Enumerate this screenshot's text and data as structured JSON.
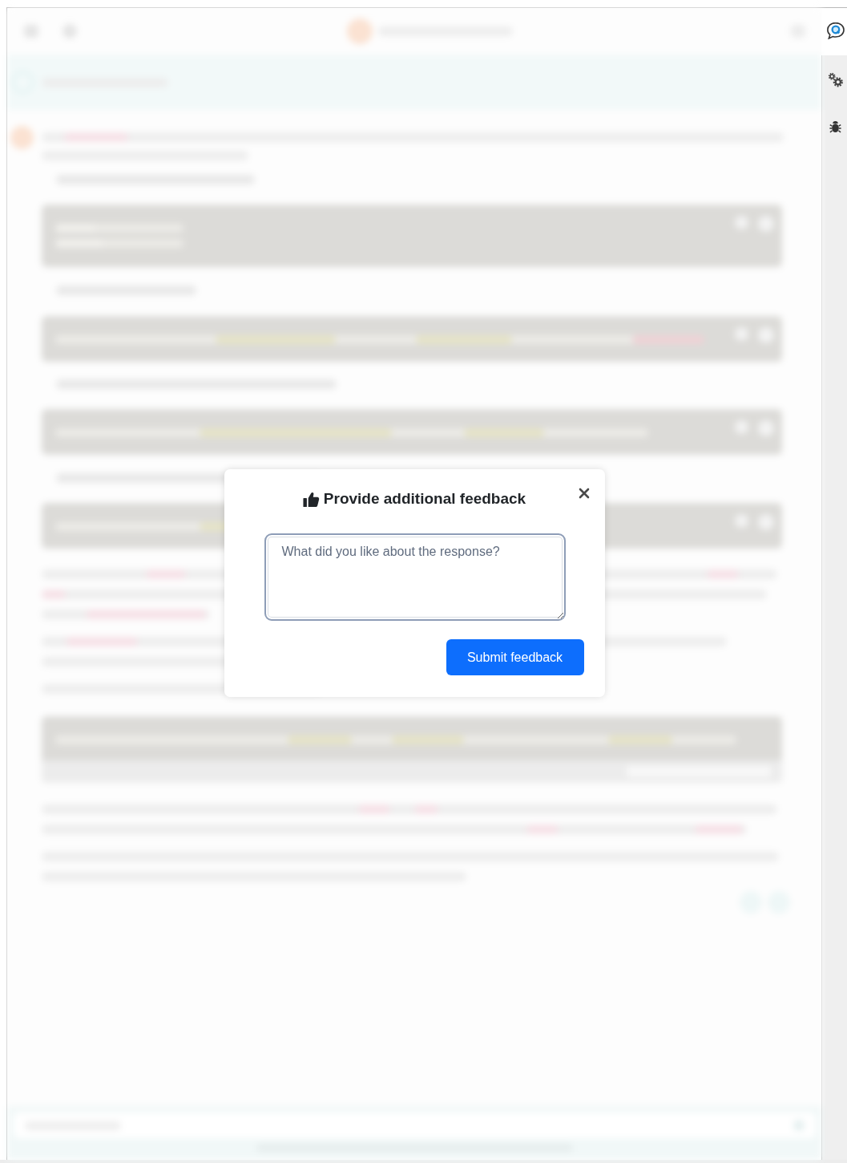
{
  "feedback_dialog": {
    "liked": true,
    "title": "Provide additional feedback",
    "feedback_field": {
      "placeholder": "What did you like about the response?"
    },
    "submit_button": "Submit feedback"
  }
}
